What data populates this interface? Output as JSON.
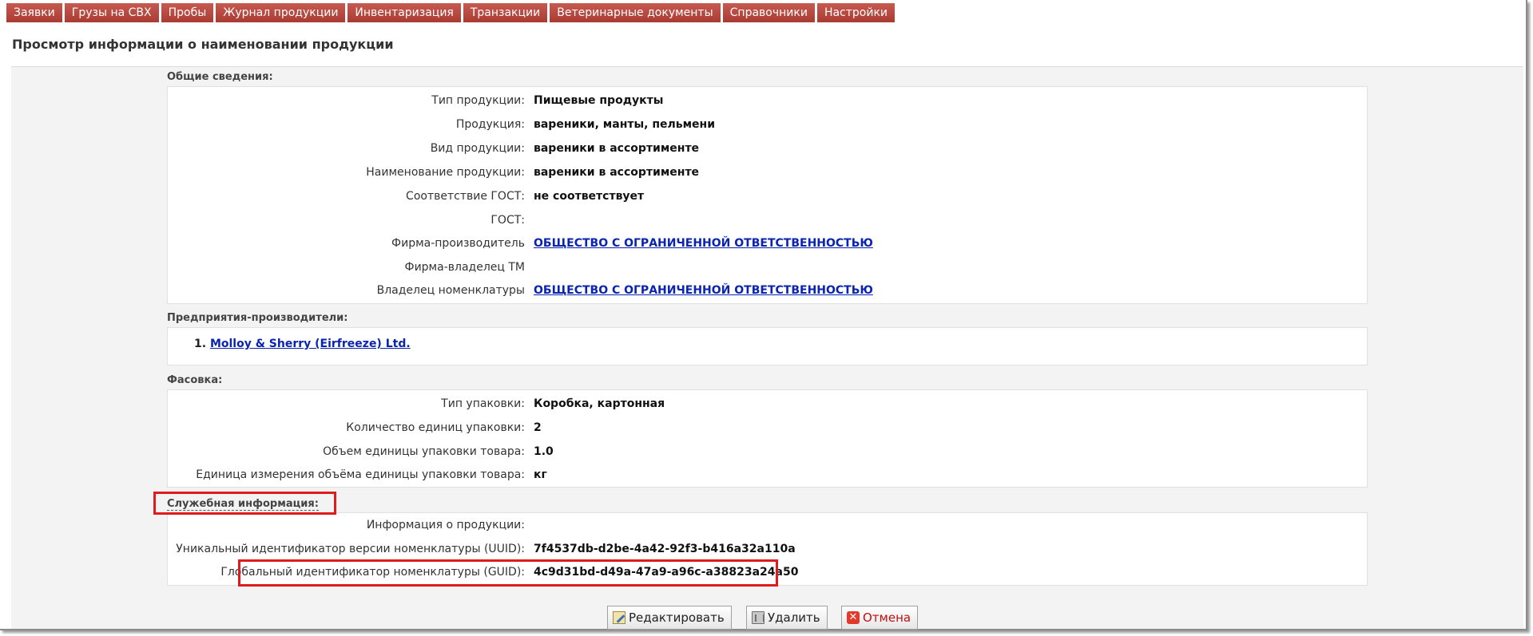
{
  "nav": {
    "tabs": [
      "Заявки",
      "Грузы на СВХ",
      "Пробы",
      "Журнал продукции",
      "Инвентаризация",
      "Транзакции",
      "Ветеринарные документы",
      "Справочники",
      "Настройки"
    ]
  },
  "page": {
    "title": "Просмотр информации о наименовании продукции"
  },
  "general": {
    "label": "Общие сведения:",
    "rows": [
      {
        "label": "Тип продукции:",
        "value": "Пищевые продукты"
      },
      {
        "label": "Продукция:",
        "value": "вареники, манты, пельмени"
      },
      {
        "label": "Вид продукции:",
        "value": "вареники в ассортименте"
      },
      {
        "label": "Наименование продукции:",
        "value": "вареники в ассортименте"
      },
      {
        "label": "Соответствие ГОСТ:",
        "value": "не соответствует"
      },
      {
        "label": "ГОСТ:",
        "value": ""
      },
      {
        "label": "Фирма-производитель",
        "value": "ОБЩЕСТВО С ОГРАНИЧЕННОЙ ОТВЕТСТВЕННОСТЬЮ"
      },
      {
        "label": "Фирма-владелец ТМ",
        "value": ""
      },
      {
        "label": "Владелец номенклатуры",
        "value": "ОБЩЕСТВО С ОГРАНИЧЕННОЙ ОТВЕТСТВЕННОСТЬЮ"
      }
    ]
  },
  "producers": {
    "label": "Предприятия-производители:",
    "items": [
      {
        "num": "1.",
        "name": "Molloy & Sherry (Eirfreeze) Ltd."
      }
    ]
  },
  "packing": {
    "label": "Фасовка:",
    "rows": [
      {
        "label": "Тип упаковки:",
        "value": "Коробка, картонная"
      },
      {
        "label": "Количество единиц упаковки:",
        "value": "2"
      },
      {
        "label": "Объем единицы упаковки товара:",
        "value": "1.0"
      },
      {
        "label": "Единица измерения объёма единицы упаковки товара:",
        "value": "кг"
      }
    ]
  },
  "service": {
    "label": "Служебная информация:",
    "rows": [
      {
        "label": "Информация о продукции:",
        "value": ""
      },
      {
        "label": "Уникальный идентификатор версии номенклатуры (UUID):",
        "value": "7f4537db-d2be-4a42-92f3-b416a32a110a"
      },
      {
        "label": "Глобальный идентификатор номенклатуры (GUID):",
        "value": "4c9d31bd-d49a-47a9-a96c-a38823a24a50"
      }
    ]
  },
  "buttons": {
    "edit": "Редактировать",
    "delete": "Удалить",
    "cancel": "Отмена"
  },
  "colors": {
    "tab_bg": "#b0433a",
    "link": "#0a23b0",
    "highlight": "#e01b1b"
  }
}
